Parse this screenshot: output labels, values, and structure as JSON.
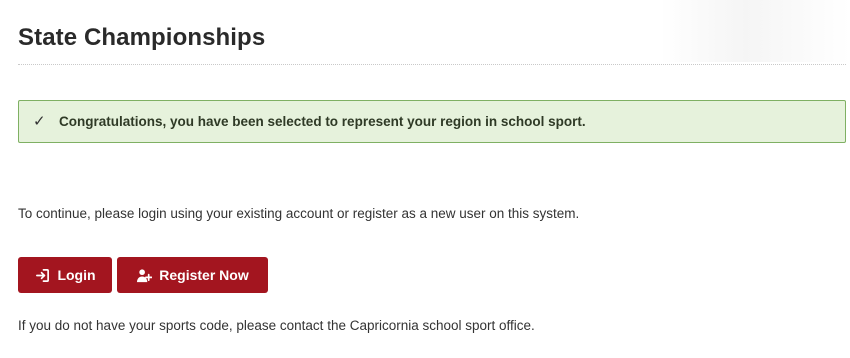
{
  "page": {
    "title": "State Championships"
  },
  "alert": {
    "icon": "check-icon",
    "message": "Congratulations, you have been selected to represent your region in school sport."
  },
  "intro": {
    "text": "To continue, please login using your existing account or register as a new user on this system."
  },
  "actions": {
    "login_label": "Login",
    "login_icon": "sign-in-icon",
    "register_label": "Register Now",
    "register_icon": "user-plus-icon"
  },
  "footer": {
    "text": "If you do not have your sports code, please contact the Capricornia school sport office."
  },
  "colors": {
    "button_bg": "#a3151f",
    "alert_bg": "#e6f2dc",
    "alert_border": "#7fb063"
  }
}
